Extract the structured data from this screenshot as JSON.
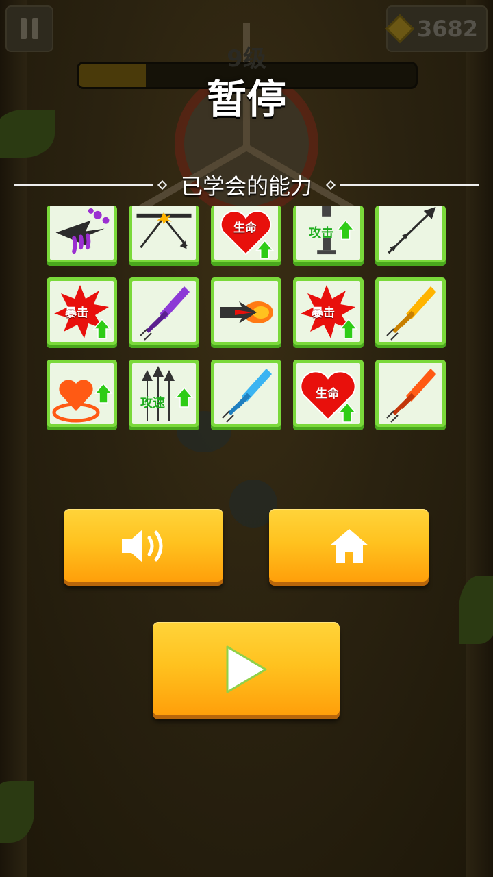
{
  "hud": {
    "gems": "3682",
    "level": "9级"
  },
  "pause_menu": {
    "title": "暂停",
    "section_title": "已学会的能力"
  },
  "abilities": [
    {
      "name": "poison-arrow"
    },
    {
      "name": "ricochet-arrow"
    },
    {
      "name": "health-up",
      "text": "生命"
    },
    {
      "name": "attack-up",
      "text": "攻击"
    },
    {
      "name": "diagonal-arrow"
    },
    {
      "name": "crit-up",
      "text": "暴击"
    },
    {
      "name": "purple-sword"
    },
    {
      "name": "fire-arrow"
    },
    {
      "name": "crit-up",
      "text": "暴击"
    },
    {
      "name": "yellow-sword"
    },
    {
      "name": "heal-circle"
    },
    {
      "name": "attack-speed-up",
      "text": "攻速"
    },
    {
      "name": "blue-sword"
    },
    {
      "name": "health-up",
      "text": "生命"
    },
    {
      "name": "orange-sword"
    }
  ],
  "buttons": {
    "sound": "speaker-icon",
    "home": "home-icon",
    "resume": "play-icon"
  },
  "colors": {
    "button_yellow": "#ffc21f",
    "tile_green": "#7ad93a",
    "crit_red": "#e8100c",
    "up_arrow_green": "#2ecc16"
  }
}
